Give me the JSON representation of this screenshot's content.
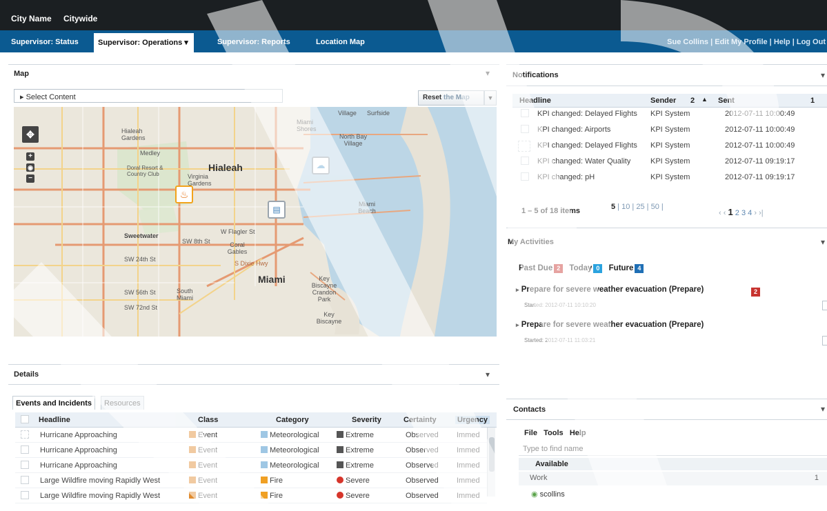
{
  "app": {
    "city": "City Name",
    "scope": "Citywide"
  },
  "nav": {
    "tabs": [
      {
        "label": "Supervisor: Status"
      },
      {
        "label": "Supervisor: Operations ▾"
      },
      {
        "label": "Supervisor: Reports"
      },
      {
        "label": "Location Map"
      }
    ],
    "user_links": "Sue Collins | Edit My Profile | Help | Log Out"
  },
  "map_panel": {
    "title": "Map",
    "select_content": "▸ Select Content",
    "reset_bold": "Reset",
    "reset_rest": " the Map",
    "labels": {
      "hialeah": "Hialeah",
      "miami": "Miami",
      "hialeah_gardens": "Hialeah Gardens",
      "medley": "Medley",
      "doral": "Doral Resort & Country Club",
      "virginia": "Virginia Gardens",
      "miami_shores": "Miami Shores",
      "north_bay": "North Bay Village",
      "surfside": "Surfside",
      "miami_beach": "Miami Beach",
      "sweetwater": "Sweetwater",
      "coral_gables": "Coral Gables",
      "south_miami": "South Miami",
      "key_biscayne": "Key Biscayne",
      "w_flagler": "W Flagler St",
      "sw8": "SW 8th St",
      "sw24": "SW 24th St",
      "sw56": "SW 56th St",
      "sw72": "SW 72nd St",
      "dixie": "S Dixie Hwy",
      "crandon": "Key Biscayne Crandon Park",
      "village": "Village"
    }
  },
  "details_panel": {
    "title": "Details",
    "tabs": [
      "Events and Incidents",
      "Resources"
    ],
    "columns": [
      "Headline",
      "Class",
      "Category",
      "Severity",
      "Certainty",
      "Urgency"
    ],
    "rows": [
      {
        "headline": "Hurricane Approaching",
        "class": "Event",
        "category": "Meteorological",
        "severity": "Extreme",
        "certainty": "Observed",
        "urgency": "Immed"
      },
      {
        "headline": "Hurricane Approaching",
        "class": "Event",
        "category": "Meteorological",
        "severity": "Extreme",
        "certainty": "Observed",
        "urgency": "Immed"
      },
      {
        "headline": "Hurricane Approaching",
        "class": "Event",
        "category": "Meteorological",
        "severity": "Extreme",
        "certainty": "Observed",
        "urgency": "Immed"
      },
      {
        "headline": "Large Wildfire moving Rapidly West",
        "class": "Event",
        "category": "Fire",
        "severity": "Severe",
        "certainty": "Observed",
        "urgency": "Immed"
      },
      {
        "headline": "Large Wildfire moving Rapidly West",
        "class": "Event",
        "category": "Fire",
        "severity": "Severe",
        "certainty": "Observed",
        "urgency": "Immed"
      }
    ]
  },
  "notifications": {
    "title": "Notifications",
    "columns": {
      "headline": "Headline",
      "sender": "Sender",
      "sort_index": "2",
      "sent": "Sent",
      "count": "1"
    },
    "rows": [
      {
        "headline": "KPI changed: Delayed Flights",
        "sender": "KPI System",
        "sent": "2012-07-11 10:00:49"
      },
      {
        "headline": "KPI changed: Airports",
        "sender": "KPI System",
        "sent": "2012-07-11 10:00:49"
      },
      {
        "headline": "KPI changed: Delayed Flights",
        "sender": "KPI System",
        "sent": "2012-07-11 10:00:49"
      },
      {
        "headline": "KPI changed: Water Quality",
        "sender": "KPI System",
        "sent": "2012-07-11 09:19:17"
      },
      {
        "headline": "KPI changed: pH",
        "sender": "KPI System",
        "sent": "2012-07-11 09:19:17"
      }
    ],
    "pager": {
      "range": "1 – 5 of 18 items",
      "page_sizes": [
        "5",
        "10",
        "25",
        "50"
      ],
      "pages": [
        "1",
        "2",
        "3",
        "4"
      ]
    }
  },
  "activities": {
    "title": "My Activities",
    "filters": [
      {
        "label": "Past Due",
        "count": "2",
        "color": "#c7332f"
      },
      {
        "label": "Today",
        "count": "0",
        "color": "#2ba3df"
      },
      {
        "label": "Future",
        "count": "4",
        "color": "#1f6fb5"
      }
    ],
    "items": [
      {
        "title": "Prepare for severe weather evacuation (Prepare)",
        "started": "Started: 2012-07-11 10:10:20",
        "badge": "2"
      },
      {
        "title": "Prepare for severe weather evacuation (Prepare)",
        "started": "Started: 2012-07-11 11:03:21",
        "badge": ""
      }
    ]
  },
  "contacts": {
    "title": "Contacts",
    "menu": [
      "File",
      "Tools",
      "Help"
    ],
    "search_placeholder": "Type to find name",
    "group_header": "Available",
    "group": {
      "name": "Work",
      "count": "1"
    },
    "contact": "scollins"
  },
  "colors": {
    "topbar": "#1b1f22",
    "navbar": "#0b5a91",
    "accent": "#1f6fb5",
    "alert": "#c7332f"
  }
}
